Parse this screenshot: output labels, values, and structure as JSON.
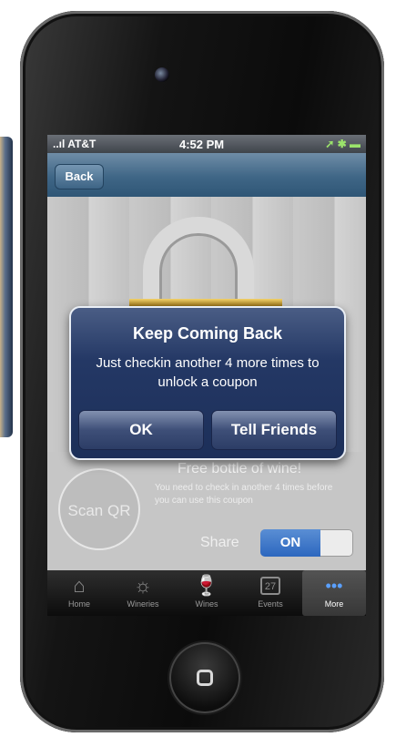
{
  "status_bar": {
    "carrier": "..ıl AT&T",
    "time": "4:52 PM",
    "right_icons": "➚ ✱ ▬"
  },
  "nav": {
    "back_label": "Back"
  },
  "coupon": {
    "title": "Free bottle of wine!",
    "description": "You need to check in another 4 times before you can use this coupon"
  },
  "scan": {
    "label": "Scan QR"
  },
  "share": {
    "label": "Share",
    "toggle": "ON"
  },
  "alert": {
    "title": "Keep Coming Back",
    "message": "Just checkin another 4 more times to unlock a coupon",
    "ok_label": "OK",
    "tell_label": "Tell Friends"
  },
  "tabs": [
    {
      "label": "Home",
      "icon": "home-icon"
    },
    {
      "label": "Wineries",
      "icon": "sun-icon"
    },
    {
      "label": "Wines",
      "icon": "wine-glass-icon"
    },
    {
      "label": "Events",
      "icon": "calendar-icon"
    },
    {
      "label": "More",
      "icon": "more-dots-icon"
    }
  ],
  "calendar_day": "27",
  "colors": {
    "accent": "#2c67bf",
    "nav": "#3f6686",
    "alert_bg": "#243865"
  }
}
